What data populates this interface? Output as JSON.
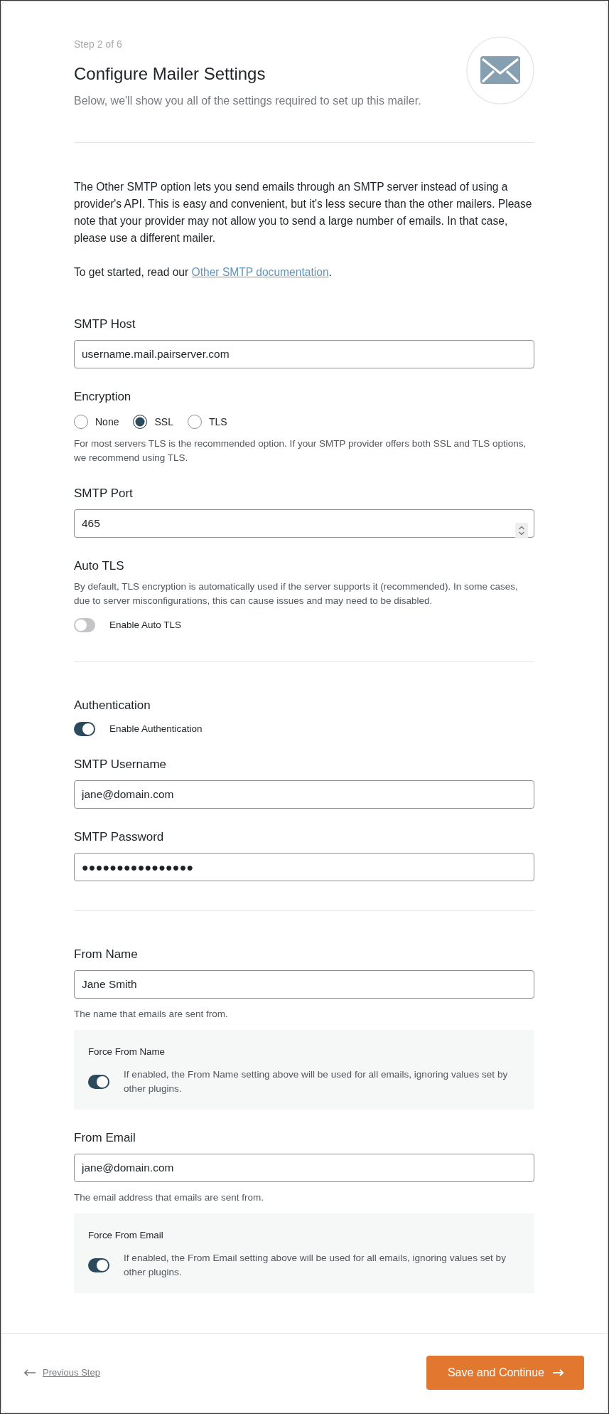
{
  "header": {
    "step": "Step 2 of 6",
    "title": "Configure Mailer Settings",
    "subtitle": "Below, we'll show you all of the settings required to set up this mailer."
  },
  "intro": {
    "paragraph": "The Other SMTP option lets you send emails through an SMTP server instead of using a provider's API. This is easy and convenient, but it's less secure than the other mailers. Please note that your provider may not allow you to send a large number of emails. In that case, please use a different mailer.",
    "link_prefix": "To get started, read our ",
    "link": "Other SMTP documentation",
    "link_suffix": "."
  },
  "groups": [
    {
      "fields": [
        {
          "kind": "text",
          "label": "SMTP Host",
          "value": "username.mail.pairserver.com"
        },
        {
          "kind": "radios",
          "label": "Encryption",
          "options": [
            {
              "label": "None",
              "selected": false
            },
            {
              "label": "SSL",
              "selected": true
            },
            {
              "label": "TLS",
              "selected": false
            }
          ],
          "help": "For most servers TLS is the recommended option. If your SMTP provider offers both SSL and TLS options, we recommend using TLS."
        },
        {
          "kind": "number",
          "label": "SMTP Port",
          "value": "465"
        },
        {
          "kind": "toggle",
          "label": "Auto TLS",
          "description": "By default, TLS encryption is automatically used if the server supports it (recommended). In some cases, due to server misconfigurations, this can cause issues and may need to be disabled.",
          "toggle_label": "Enable Auto TLS",
          "on": false
        }
      ]
    },
    {
      "fields": [
        {
          "kind": "toggle",
          "label": "Authentication",
          "toggle_label": "Enable Authentication",
          "on": true
        },
        {
          "kind": "text",
          "label": "SMTP Username",
          "value": "jane@domain.com"
        },
        {
          "kind": "password",
          "label": "SMTP Password",
          "value": "●●●●●●●●●●●●●●●●"
        }
      ]
    },
    {
      "fields": [
        {
          "kind": "text",
          "label": "From Name",
          "value": "Jane Smith",
          "help": "The name that emails are sent from.",
          "force": {
            "title": "Force From Name",
            "description": "If enabled, the From Name setting above will be used for all emails, ignoring values set by other plugins.",
            "on": true
          }
        },
        {
          "kind": "text",
          "label": "From Email",
          "value": "jane@domain.com",
          "help": "The email address that emails are sent from.",
          "force": {
            "title": "Force From Email",
            "description": "If enabled, the From Email setting above will be used for all emails, ignoring values set by other plugins.",
            "on": true
          }
        }
      ]
    }
  ],
  "footer": {
    "back": "Previous Step",
    "next": "Save and Continue"
  }
}
